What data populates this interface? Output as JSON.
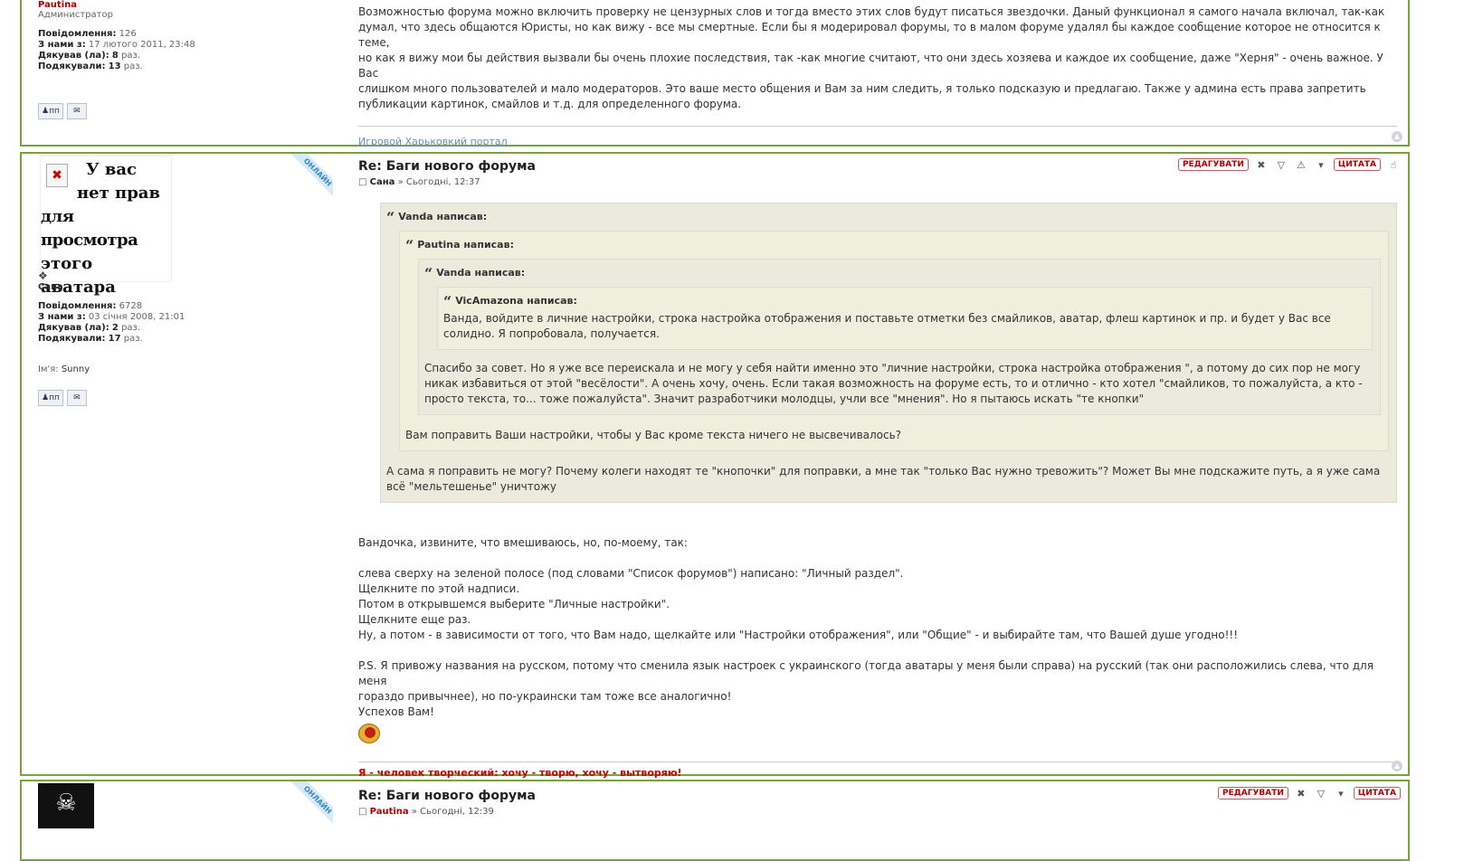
{
  "post1": {
    "user": {
      "name": "Pautina",
      "rank": "Администратор",
      "stats": {
        "posts_label": "Повідомлення:",
        "posts": "126",
        "joined_label": "З нами з:",
        "joined": "17 лютого 2011, 23:48",
        "thanked_label": "Дякував (ла):",
        "thanked": "8",
        "thanked_suffix": " раз.",
        "received_label": "Подякували:",
        "received": "13",
        "received_suffix": " раз."
      }
    },
    "text_lines": [
      "Возможностью форума можно включить проверку не цензурных слов и тогда вместо этих слов будут писаться звездочки. Даный функционал я самого начала включал, так-как",
      "думал, что здесь общаются Юристы, но как вижу - все мы смертные. Если бы я модерировал форумы, то в малом форуме удалял бы каждое сообщение которое не относится к теме,",
      "но как я вижу мои бы действия вызвали бы очень плохие последствия, так -как многие считают, что они здесь хозяева и каждое их сообщение, даже \"Херня\" - очень важное. У Вас",
      "слишком много пользователей и мало модераторов. Это ваше место общения и Вам за ним следить, я только подсказую и предлагаю. Также у админа есть права запретить",
      "публикации картинок, смайлов и т.д. для определенного форума."
    ],
    "signature_link": "Игровой Харьковкий портал"
  },
  "post2": {
    "avatar_text_lines": [
      "У вас",
      "нет прав",
      "для просмотра",
      "этого аватара"
    ],
    "online": "ОНЛАЙН",
    "user": {
      "name": "Сана",
      "stats": {
        "posts_label": "Повідомлення:",
        "posts": "6728",
        "joined_label": "З нами з:",
        "joined": "03 січня 2008, 21:01",
        "thanked_label": "Дякував (ла):",
        "thanked": "2",
        "thanked_suffix": " раз.",
        "received_label": "Подякували:",
        "received": "17",
        "received_suffix": " раз."
      },
      "name_field_label": "Ім'я:",
      "name_field": "Sunny"
    },
    "title": "Re: Баги нового форума",
    "meta_author": "Сана",
    "meta_time": " » Сьогодні, 12:37",
    "actions": {
      "edit": "РЕДАГУВАТИ",
      "quote": "ЦИТАТА"
    },
    "quote1": {
      "author": "Vanda написав:",
      "text": "А сама я поправить не могу? Почему колеги находят те \"кнопочки\" для поправки, а мне так \"только Вас нужно тревожить\"? Может Вы мне подскажите путь, а я уже сама всё \"мельтешенье\" уничтожу"
    },
    "quote2": {
      "author": "Pautina написав:",
      "text": "Вам поправить Ваши настройки, чтобы у Вас кроме текста ничего не высвечивалось?"
    },
    "quote3": {
      "author": "Vanda написав:",
      "text": "Спасибо за совет. Но я уже все переискала и не могу у себя найти именно это \"личние настройки, строка настройка отображения \", а потому до сих пор не могу никак избавиться от этой \"весёлости\". А очень хочу, очень. Если такая возможность на форуме есть, то и отлично - кто хотел \"смайликов, то пожалуйста, а кто - просто текста, то... тоже пожалуйста\". Значит разработчики молодцы, учли все \"мнения\". Но я пытаюсь искать \"те кнопки\""
    },
    "quote4": {
      "author": "VicAmazona написав:",
      "text": "Ванда, войдите в личние настройки, строка настройка отображения и поставьте отметки без смайликов, аватар, флеш картинок и пр. и будет у Вас все солидно. Я попробовала, получается."
    },
    "body_lines": [
      "Вандочка, извините, что вмешиваюсь, но, по-моему, так:",
      "",
      "слева сверху на зеленой полосе (под словами \"Список форумов\") написано: \"Личный раздел\".",
      "Щелкните по этой надписи.",
      "Потом в открывшемся выберите \"Личные настройки\".",
      "Щелкните еще раз.",
      "Ну, а потом - в зависимости от того, что Вам надо, щелкайте или \"Настройки отображения\", или \"Общие\" - и выбирайте там, что Вашей душе угодно!!!",
      "",
      "P.S. Я привожу названия на русском, потому что сменила язык настроек с украинского (тогда аватары у меня были справа) на русский (так они расположились слева, что для меня",
      "гораздо привычнее), но по-украински там тоже все аналогично!",
      "Успехов Вам!"
    ],
    "signature": "Я - человек творческий: хочу - творю, хочу - вытворяю!"
  },
  "post3": {
    "online": "ОНЛАЙН",
    "title": "Re: Баги нового форума",
    "meta_author": "Pautina",
    "meta_time": " » Сьогодні, 12:39",
    "actions": {
      "edit": "РЕДАГУВАТИ",
      "quote": "ЦИТАТА"
    }
  },
  "profile_buttons": {
    "pm": "пп"
  },
  "colors": {
    "border": "#7aa33f",
    "quote_bg": "#ebeadd",
    "signature_red": "#cc0000",
    "admin_red": "#b00000"
  }
}
